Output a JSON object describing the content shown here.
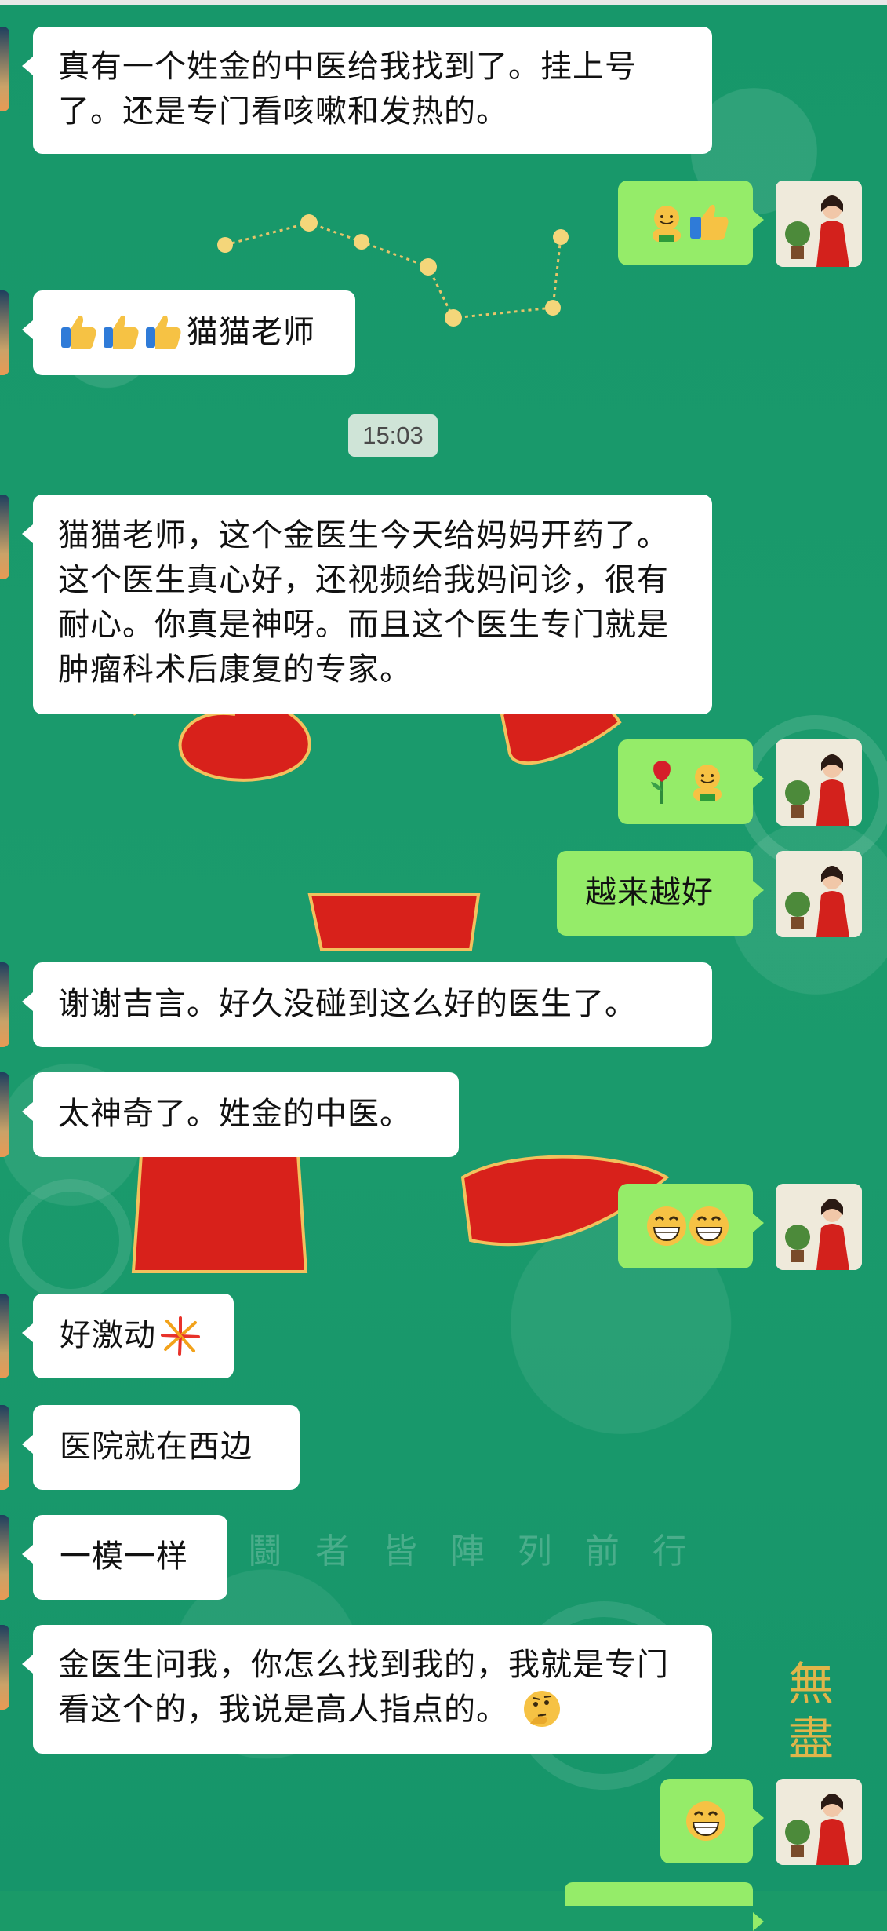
{
  "conversation": {
    "timestamp": "15:03",
    "messages": [
      {
        "side": "in",
        "text": "真有一个姓金的中医给我找到了。挂上号了。还是专门看咳嗽和发热的。"
      },
      {
        "side": "out",
        "text": "",
        "icons": [
          "smiling-face-icon",
          "thumbs-up-icon"
        ]
      },
      {
        "side": "in",
        "text": "猫猫老师",
        "icons": [
          "thumbs-up-icon",
          "thumbs-up-icon",
          "thumbs-up-icon"
        ]
      },
      {
        "side": "in",
        "text": "猫猫老师，这个金医生今天给妈妈开药了。这个医生真心好，还视频给我妈问诊，很有耐心。你真是神呀。而且这个医生专门就是肿瘤科术后康复的专家。"
      },
      {
        "side": "out",
        "text": "",
        "icons": [
          "rose-icon",
          "smiling-face-icon"
        ]
      },
      {
        "side": "out",
        "text": "越来越好"
      },
      {
        "side": "in",
        "text": "谢谢吉言。好久没碰到这么好的医生了。"
      },
      {
        "side": "in",
        "text": "太神奇了。姓金的中医。"
      },
      {
        "side": "out",
        "text": "",
        "icons": [
          "grin-icon",
          "grin-icon"
        ]
      },
      {
        "side": "in",
        "text": "好激动",
        "icons": [
          "fireworks-icon"
        ]
      },
      {
        "side": "in",
        "text": "医院就在西边"
      },
      {
        "side": "in",
        "text": "一模一样"
      },
      {
        "side": "in",
        "text": "金医生问我，你怎么找到我的，我就是专门看这个的，我说是高人指点的。",
        "icons": [
          "thinking-face-icon"
        ]
      },
      {
        "side": "out",
        "text": "",
        "icons": [
          "grin-icon"
        ]
      }
    ]
  },
  "background": {
    "caption": "兵 鬪 者 皆 陣 列 前 行",
    "seal_text": "無盡"
  },
  "colors": {
    "chat_bg": "#1a9a68",
    "incoming_bubble": "#ffffff",
    "outgoing_bubble": "#95ec69",
    "timestamp_bg": "#cfe4d7"
  }
}
